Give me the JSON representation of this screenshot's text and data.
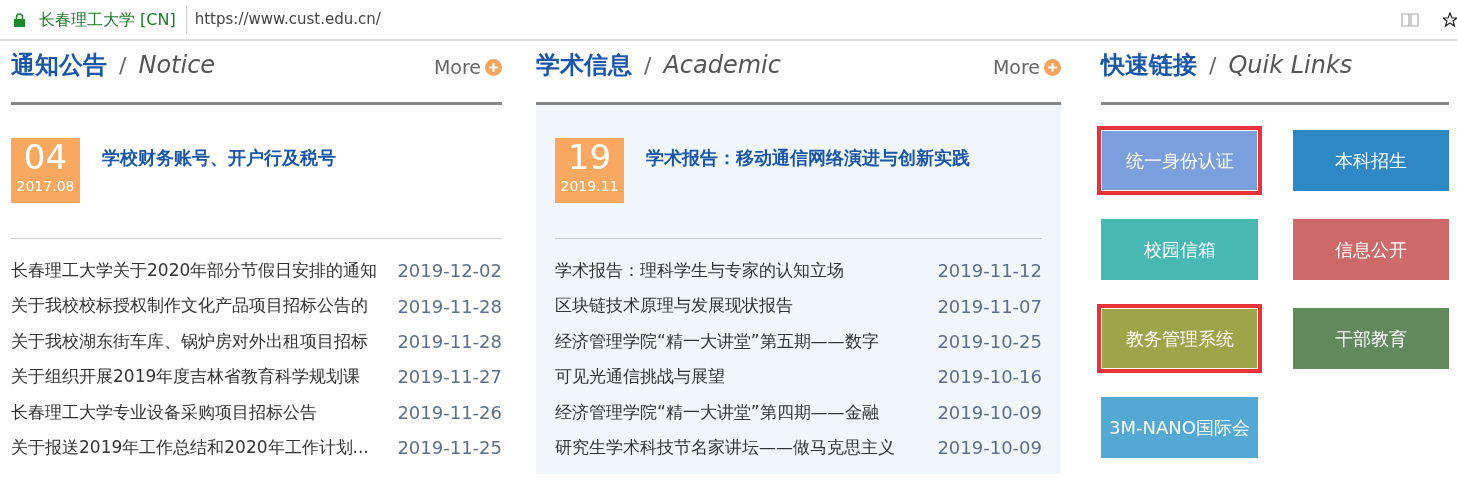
{
  "browser": {
    "site_name": "长春理工大学 [CN]",
    "url": "https://www.cust.edu.cn/"
  },
  "sections": [
    {
      "kind": "news",
      "title": "通知公告",
      "separator": "/",
      "subtitle": "Notice",
      "more": "More",
      "shaded": false,
      "featured": {
        "day": "04",
        "month": "2017.08",
        "title": "学校财务账号、开户行及税号"
      },
      "items": [
        {
          "title": "长春理工大学关于2020年部分节假日安排的通知",
          "date": "2019-12-02"
        },
        {
          "title": "关于我校校标授权制作文化产品项目招标公告的",
          "date": "2019-11-28"
        },
        {
          "title": "关于我校湖东街车库、锅炉房对外出租项目招标",
          "date": "2019-11-28"
        },
        {
          "title": "关于组织开展2019年度吉林省教育科学规划课",
          "date": "2019-11-27"
        },
        {
          "title": "长春理工大学专业设备采购项目招标公告",
          "date": "2019-11-26"
        },
        {
          "title": "关于报送2019年工作总结和2020年工作计划...",
          "date": "2019-11-25"
        }
      ]
    },
    {
      "kind": "news",
      "title": "学术信息",
      "separator": "/",
      "subtitle": "Academic",
      "more": "More",
      "shaded": true,
      "featured": {
        "day": "19",
        "month": "2019.11",
        "title": "学术报告：移动通信网络演进与创新实践"
      },
      "items": [
        {
          "title": "学术报告：理科学生与专家的认知立场",
          "date": "2019-11-12"
        },
        {
          "title": "区块链技术原理与发展现状报告",
          "date": "2019-11-07"
        },
        {
          "title": "经济管理学院“精一大讲堂”第五期——数字",
          "date": "2019-10-25"
        },
        {
          "title": "可见光通信挑战与展望",
          "date": "2019-10-16"
        },
        {
          "title": "经济管理学院“精一大讲堂”第四期——金融",
          "date": "2019-10-09"
        },
        {
          "title": "研究生学术科技节名家讲坛——做马克思主义",
          "date": "2019-10-09"
        }
      ]
    },
    {
      "kind": "links",
      "title": "快速链接",
      "separator": "/",
      "subtitle": "Quik Links",
      "links": [
        {
          "label": "统一身份认证",
          "color": "#7b9fdc",
          "highlighted": true
        },
        {
          "label": "本科招生",
          "color": "#2e88c6",
          "highlighted": false
        },
        {
          "label": "校园信箱",
          "color": "#48b8b3",
          "highlighted": false
        },
        {
          "label": "信息公开",
          "color": "#cd6969",
          "highlighted": false
        },
        {
          "label": "教务管理系统",
          "color": "#9ea449",
          "highlighted": true
        },
        {
          "label": "干部教育",
          "color": "#62885e",
          "highlighted": false
        },
        {
          "label": "3M-NANO国际会",
          "color": "#53a8d4",
          "highlighted": false
        }
      ]
    }
  ]
}
